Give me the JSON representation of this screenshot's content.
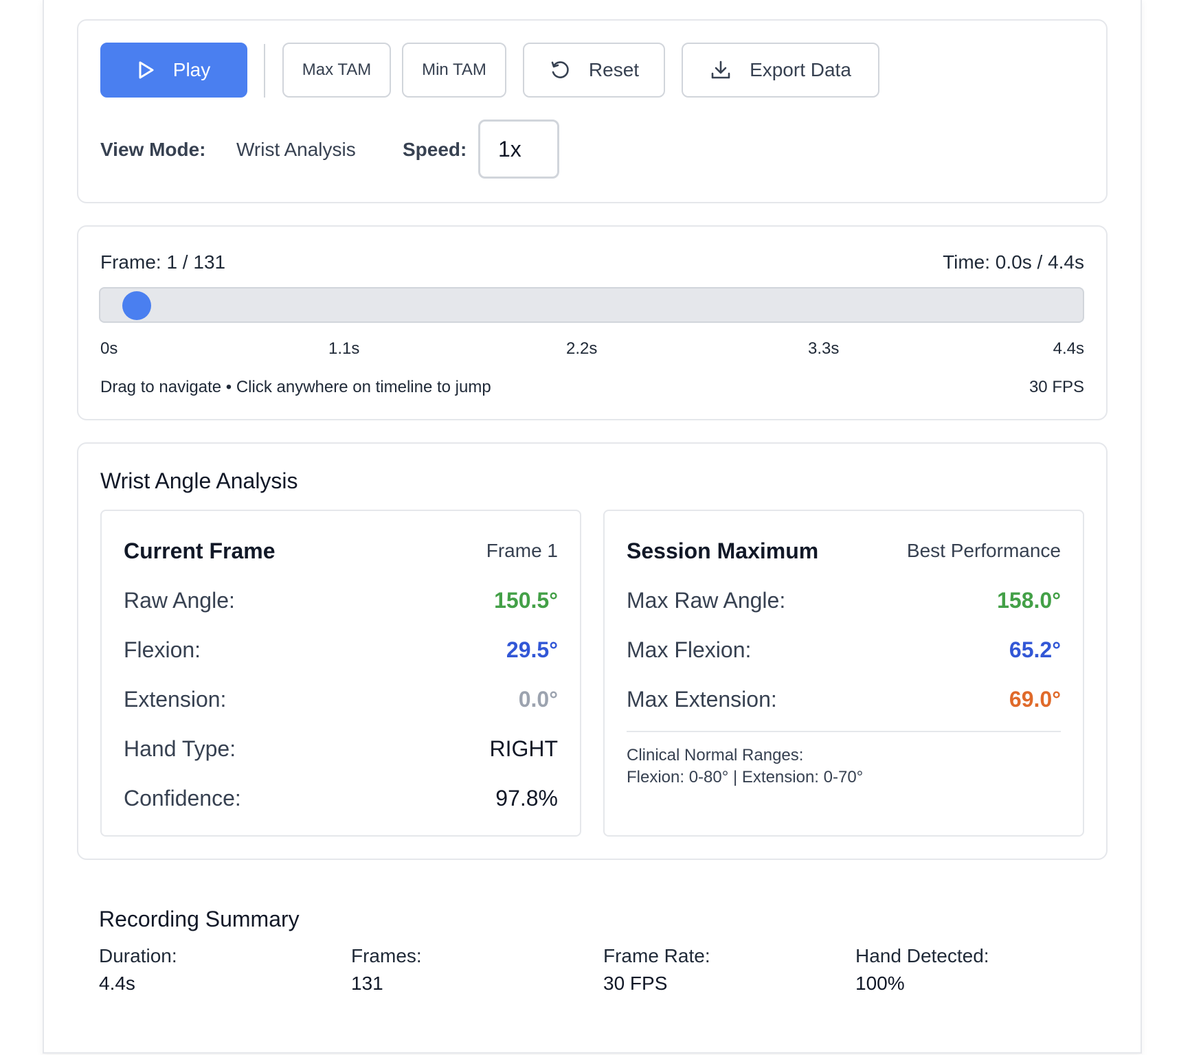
{
  "controls": {
    "play_label": "Play",
    "max_tam_label": "Max TAM",
    "min_tam_label": "Min TAM",
    "reset_label": "Reset",
    "export_label": "Export Data",
    "view_mode_label": "View Mode:",
    "view_mode_value": "Wrist Analysis",
    "speed_label": "Speed:",
    "speed_value": "1x"
  },
  "timeline": {
    "frame_text": "Frame: 1 / 131",
    "time_text": "Time: 0.0s / 4.4s",
    "progress": 0.0,
    "ticks": [
      "0s",
      "1.1s",
      "2.2s",
      "3.3s",
      "4.4s"
    ],
    "hint": "Drag to navigate • Click anywhere on timeline to jump",
    "fps": "30 FPS"
  },
  "analysis": {
    "title": "Wrist Angle Analysis",
    "current": {
      "title": "Current Frame",
      "subtitle": "Frame 1",
      "rows": [
        {
          "label": "Raw Angle:",
          "value": "150.5°"
        },
        {
          "label": "Flexion:",
          "value": "29.5°"
        },
        {
          "label": "Extension:",
          "value": "0.0°"
        },
        {
          "label": "Hand Type:",
          "value": "RIGHT"
        },
        {
          "label": "Confidence:",
          "value": "97.8%"
        }
      ]
    },
    "session": {
      "title": "Session Maximum",
      "subtitle": "Best Performance",
      "rows": [
        {
          "label": "Max Raw Angle:",
          "value": "158.0°"
        },
        {
          "label": "Max Flexion:",
          "value": "65.2°"
        },
        {
          "label": "Max Extension:",
          "value": "69.0°"
        }
      ],
      "ranges_title": "Clinical Normal Ranges:",
      "ranges_text": "Flexion: 0-80° | Extension: 0-70°"
    }
  },
  "summary": {
    "title": "Recording Summary",
    "items": [
      {
        "label": "Duration:",
        "value": "4.4s"
      },
      {
        "label": "Frames:",
        "value": "131"
      },
      {
        "label": "Frame Rate:",
        "value": "30 FPS"
      },
      {
        "label": "Hand Detected:",
        "value": "100%"
      }
    ]
  },
  "colors": {
    "accent": "#4a7ff0",
    "green": "#43a047",
    "blue": "#3257d6",
    "orange": "#e06a2a",
    "muted": "#9ca3af"
  }
}
